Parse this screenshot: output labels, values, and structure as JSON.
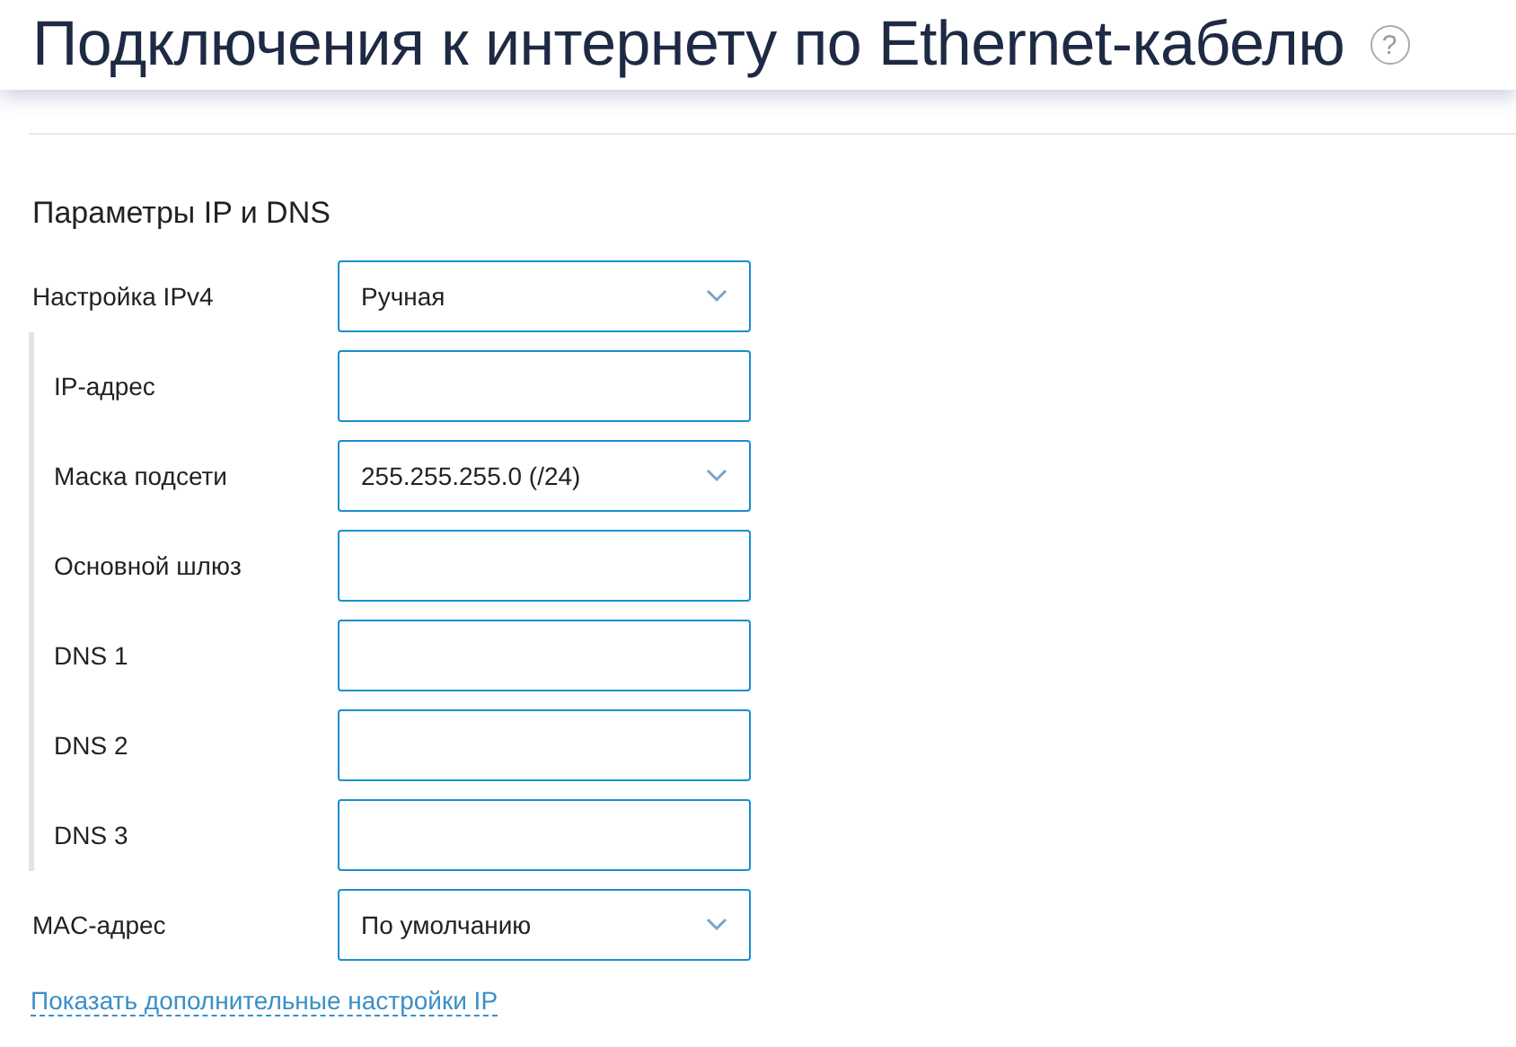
{
  "header": {
    "title": "Подключения к интернету по Ethernet-кабелю",
    "help": "?"
  },
  "section": {
    "title": "Параметры IP и DNS",
    "rows": [
      {
        "label": "Настройка IPv4",
        "kind": "select",
        "value": "Ручная",
        "children": [
          {
            "label": "IP-адрес",
            "kind": "input"
          },
          {
            "label": "Маска подсети",
            "kind": "select",
            "value": "255.255.255.0 (/24)"
          },
          {
            "label": "Основной шлюз",
            "kind": "input"
          },
          {
            "label": "DNS 1",
            "kind": "input"
          },
          {
            "label": "DNS 2",
            "kind": "input"
          },
          {
            "label": "DNS 3",
            "kind": "input"
          }
        ]
      },
      {
        "label": "MAC-адрес",
        "kind": "select",
        "value": "По умолчанию"
      }
    ]
  },
  "link": "Показать дополнительные настройки IP"
}
